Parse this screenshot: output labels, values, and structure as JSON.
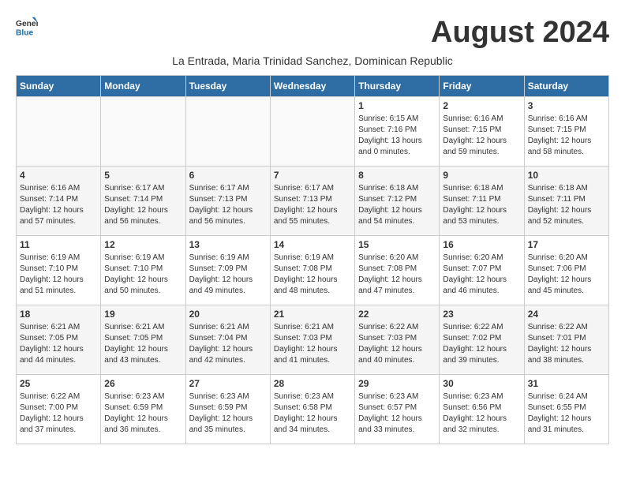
{
  "header": {
    "logo_general": "General",
    "logo_blue": "Blue",
    "month_year": "August 2024",
    "subtitle": "La Entrada, Maria Trinidad Sanchez, Dominican Republic"
  },
  "days_of_week": [
    "Sunday",
    "Monday",
    "Tuesday",
    "Wednesday",
    "Thursday",
    "Friday",
    "Saturday"
  ],
  "weeks": [
    [
      {
        "day": "",
        "info": ""
      },
      {
        "day": "",
        "info": ""
      },
      {
        "day": "",
        "info": ""
      },
      {
        "day": "",
        "info": ""
      },
      {
        "day": "1",
        "info": "Sunrise: 6:15 AM\nSunset: 7:16 PM\nDaylight: 13 hours\nand 0 minutes."
      },
      {
        "day": "2",
        "info": "Sunrise: 6:16 AM\nSunset: 7:15 PM\nDaylight: 12 hours\nand 59 minutes."
      },
      {
        "day": "3",
        "info": "Sunrise: 6:16 AM\nSunset: 7:15 PM\nDaylight: 12 hours\nand 58 minutes."
      }
    ],
    [
      {
        "day": "4",
        "info": "Sunrise: 6:16 AM\nSunset: 7:14 PM\nDaylight: 12 hours\nand 57 minutes."
      },
      {
        "day": "5",
        "info": "Sunrise: 6:17 AM\nSunset: 7:14 PM\nDaylight: 12 hours\nand 56 minutes."
      },
      {
        "day": "6",
        "info": "Sunrise: 6:17 AM\nSunset: 7:13 PM\nDaylight: 12 hours\nand 56 minutes."
      },
      {
        "day": "7",
        "info": "Sunrise: 6:17 AM\nSunset: 7:13 PM\nDaylight: 12 hours\nand 55 minutes."
      },
      {
        "day": "8",
        "info": "Sunrise: 6:18 AM\nSunset: 7:12 PM\nDaylight: 12 hours\nand 54 minutes."
      },
      {
        "day": "9",
        "info": "Sunrise: 6:18 AM\nSunset: 7:11 PM\nDaylight: 12 hours\nand 53 minutes."
      },
      {
        "day": "10",
        "info": "Sunrise: 6:18 AM\nSunset: 7:11 PM\nDaylight: 12 hours\nand 52 minutes."
      }
    ],
    [
      {
        "day": "11",
        "info": "Sunrise: 6:19 AM\nSunset: 7:10 PM\nDaylight: 12 hours\nand 51 minutes."
      },
      {
        "day": "12",
        "info": "Sunrise: 6:19 AM\nSunset: 7:10 PM\nDaylight: 12 hours\nand 50 minutes."
      },
      {
        "day": "13",
        "info": "Sunrise: 6:19 AM\nSunset: 7:09 PM\nDaylight: 12 hours\nand 49 minutes."
      },
      {
        "day": "14",
        "info": "Sunrise: 6:19 AM\nSunset: 7:08 PM\nDaylight: 12 hours\nand 48 minutes."
      },
      {
        "day": "15",
        "info": "Sunrise: 6:20 AM\nSunset: 7:08 PM\nDaylight: 12 hours\nand 47 minutes."
      },
      {
        "day": "16",
        "info": "Sunrise: 6:20 AM\nSunset: 7:07 PM\nDaylight: 12 hours\nand 46 minutes."
      },
      {
        "day": "17",
        "info": "Sunrise: 6:20 AM\nSunset: 7:06 PM\nDaylight: 12 hours\nand 45 minutes."
      }
    ],
    [
      {
        "day": "18",
        "info": "Sunrise: 6:21 AM\nSunset: 7:05 PM\nDaylight: 12 hours\nand 44 minutes."
      },
      {
        "day": "19",
        "info": "Sunrise: 6:21 AM\nSunset: 7:05 PM\nDaylight: 12 hours\nand 43 minutes."
      },
      {
        "day": "20",
        "info": "Sunrise: 6:21 AM\nSunset: 7:04 PM\nDaylight: 12 hours\nand 42 minutes."
      },
      {
        "day": "21",
        "info": "Sunrise: 6:21 AM\nSunset: 7:03 PM\nDaylight: 12 hours\nand 41 minutes."
      },
      {
        "day": "22",
        "info": "Sunrise: 6:22 AM\nSunset: 7:03 PM\nDaylight: 12 hours\nand 40 minutes."
      },
      {
        "day": "23",
        "info": "Sunrise: 6:22 AM\nSunset: 7:02 PM\nDaylight: 12 hours\nand 39 minutes."
      },
      {
        "day": "24",
        "info": "Sunrise: 6:22 AM\nSunset: 7:01 PM\nDaylight: 12 hours\nand 38 minutes."
      }
    ],
    [
      {
        "day": "25",
        "info": "Sunrise: 6:22 AM\nSunset: 7:00 PM\nDaylight: 12 hours\nand 37 minutes."
      },
      {
        "day": "26",
        "info": "Sunrise: 6:23 AM\nSunset: 6:59 PM\nDaylight: 12 hours\nand 36 minutes."
      },
      {
        "day": "27",
        "info": "Sunrise: 6:23 AM\nSunset: 6:59 PM\nDaylight: 12 hours\nand 35 minutes."
      },
      {
        "day": "28",
        "info": "Sunrise: 6:23 AM\nSunset: 6:58 PM\nDaylight: 12 hours\nand 34 minutes."
      },
      {
        "day": "29",
        "info": "Sunrise: 6:23 AM\nSunset: 6:57 PM\nDaylight: 12 hours\nand 33 minutes."
      },
      {
        "day": "30",
        "info": "Sunrise: 6:23 AM\nSunset: 6:56 PM\nDaylight: 12 hours\nand 32 minutes."
      },
      {
        "day": "31",
        "info": "Sunrise: 6:24 AM\nSunset: 6:55 PM\nDaylight: 12 hours\nand 31 minutes."
      }
    ]
  ]
}
